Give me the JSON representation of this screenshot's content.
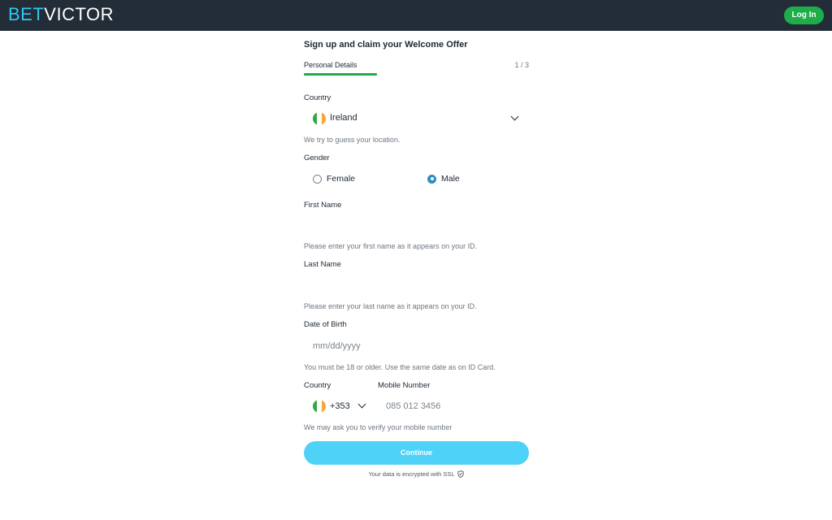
{
  "header": {
    "logo_bet": "BET",
    "logo_victor": "VICTOR",
    "login_label": "Log In"
  },
  "form": {
    "title": "Sign up and claim your Welcome Offer",
    "step_label": "Personal Details",
    "step_count": "1 / 3",
    "progress_fraction": 0.33,
    "country": {
      "label": "Country",
      "value": "Ireland",
      "flag_icon": "ireland-flag-icon",
      "hint": "We try to guess your location."
    },
    "gender": {
      "label": "Gender",
      "options": [
        "Female",
        "Male"
      ],
      "selected": "Male"
    },
    "first_name": {
      "label": "First Name",
      "value": "",
      "hint": "Please enter your first name as it appears on your ID."
    },
    "last_name": {
      "label": "Last Name",
      "value": "",
      "hint": "Please enter your last name as it appears on your ID."
    },
    "dob": {
      "label": "Date of Birth",
      "placeholder": "mm/dd/yyyy",
      "hint": "You must be 18 or older. Use the same date as on ID Card."
    },
    "phone": {
      "country_label": "Country",
      "number_label": "Mobile Number",
      "code": "+353",
      "placeholder": "085 012 3456",
      "hint": "We may ask you to verify your mobile number"
    },
    "continue_label": "Continue",
    "ssl_note": "Your data is encrypted with SSL"
  },
  "colors": {
    "header_bg": "#232d38",
    "brand_blue": "#33c6f4",
    "login_green": "#1fad4a",
    "progress_green": "#1fad4a",
    "continue_bg": "#4fd2f7",
    "radio_selected": "#2c8ec4"
  }
}
